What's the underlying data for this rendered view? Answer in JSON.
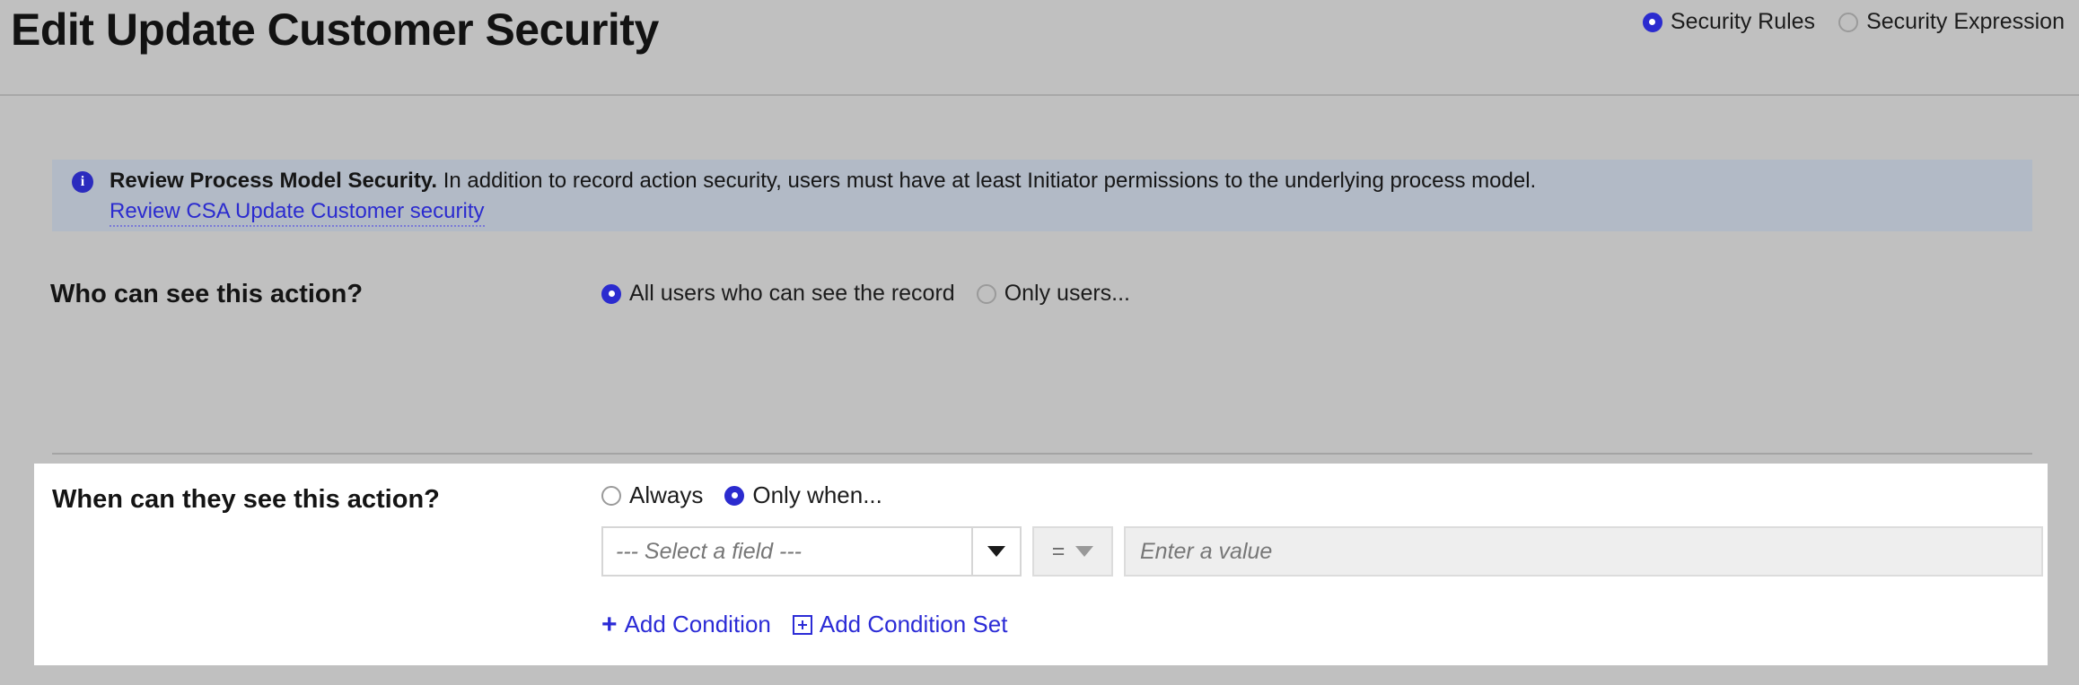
{
  "header": {
    "title": "Edit Update Customer Security",
    "mode_options": [
      {
        "label": "Security Rules",
        "selected": true
      },
      {
        "label": "Security Expression",
        "selected": false
      }
    ]
  },
  "banner": {
    "icon": "info-icon",
    "headline": "Review Process Model Security.",
    "body": "In addition to record action security, users must have at least Initiator permissions to the underlying process model.",
    "link_label": "Review CSA Update Customer security",
    "background_color": "#b2bac6",
    "link_color": "#2b2bcf"
  },
  "who_section": {
    "label": "Who can see this action?",
    "options": [
      {
        "label": "All users who can see the record",
        "selected": true
      },
      {
        "label": "Only users...",
        "selected": false
      }
    ]
  },
  "when_section": {
    "label": "When can they see this action?",
    "options": [
      {
        "label": "Always",
        "selected": false
      },
      {
        "label": "Only when...",
        "selected": true
      }
    ],
    "condition": {
      "field_placeholder": "--- Select a field ---",
      "field_dropdown_icon": "chevron-down-icon",
      "operator_value": "=",
      "operator_dropdown_icon": "chevron-down-icon",
      "value_placeholder": "Enter a value"
    },
    "actions": [
      {
        "label": "Add Condition",
        "icon": "plus-icon"
      },
      {
        "label": "Add Condition Set",
        "icon": "boxed-plus-icon"
      }
    ]
  },
  "colors": {
    "page_background": "#c0c0c0",
    "panel_background": "#ffffff",
    "accent": "#2b2bcf"
  }
}
